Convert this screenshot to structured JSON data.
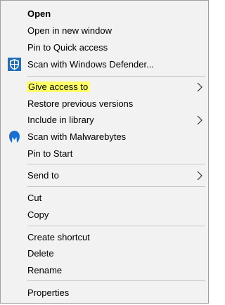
{
  "menu": {
    "items": [
      {
        "label": "Open"
      },
      {
        "label": "Open in new window"
      },
      {
        "label": "Pin to Quick access"
      },
      {
        "label": "Scan with Windows Defender...",
        "icon": "windows-defender-shield-icon"
      },
      {
        "label": "Give access to",
        "highlight_color": "#ffff66",
        "submenu": true
      },
      {
        "label": "Restore previous versions"
      },
      {
        "label": "Include in library",
        "submenu": true
      },
      {
        "label": "Scan with Malwarebytes",
        "icon": "malwarebytes-icon"
      },
      {
        "label": "Pin to Start"
      },
      {
        "label": "Send to",
        "submenu": true
      },
      {
        "label": "Cut"
      },
      {
        "label": "Copy"
      },
      {
        "label": "Create shortcut"
      },
      {
        "label": "Delete"
      },
      {
        "label": "Rename"
      },
      {
        "label": "Properties"
      }
    ]
  },
  "colors": {
    "menu_background": "#f2f2f2",
    "separator": "#c8c8c8",
    "defender_blue": "#1e6fc1",
    "malwarebytes_blue": "#1a6fd4"
  }
}
